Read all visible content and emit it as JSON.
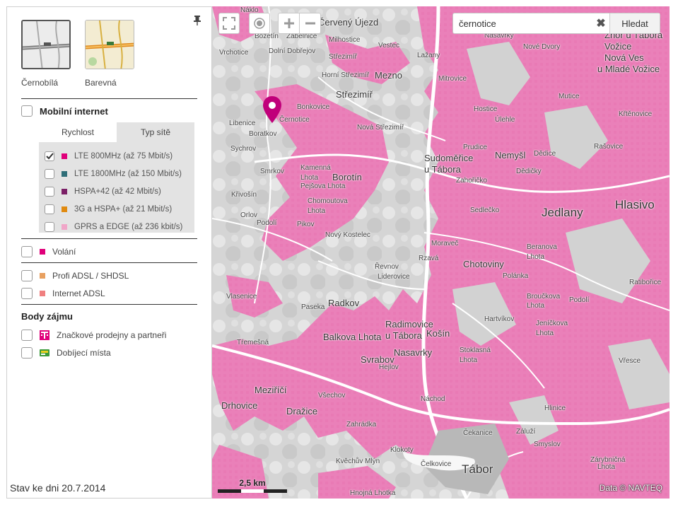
{
  "sidebar": {
    "map_styles": [
      {
        "label": "Černobílá",
        "selected": true
      },
      {
        "label": "Barevná",
        "selected": false
      }
    ],
    "mobile_internet": {
      "label": "Mobilní internet",
      "tabs": [
        "Rychlost",
        "Typ sítě"
      ],
      "options": [
        {
          "label": "LTE 800MHz (až 75 Mbit/s)",
          "color": "#e0007a",
          "checked": true
        },
        {
          "label": "LTE 1800MHz (až 150 Mbit/s)",
          "color": "#2f6e78",
          "checked": false
        },
        {
          "label": "HSPA+42 (až 42 Mbit/s)",
          "color": "#7b1f66",
          "checked": false
        },
        {
          "label": "3G a HSPA+ (až 21 Mbit/s)",
          "color": "#e08a10",
          "checked": false
        },
        {
          "label": "GPRS a EDGE (až 236 kbit/s)",
          "color": "#f0a6c8",
          "checked": false
        }
      ]
    },
    "calls": {
      "label": "Volání",
      "color": "#e0007a"
    },
    "fixed": [
      {
        "label": "Profi ADSL / SHDSL",
        "color": "#e8a060"
      },
      {
        "label": "Internet ADSL",
        "color": "#f08080"
      }
    ],
    "poi": {
      "title": "Body zájmu",
      "items": [
        {
          "label": "Značkové prodejny a partneři",
          "icon": "t-logo-icon",
          "color": "#e0007a"
        },
        {
          "label": "Dobíjecí místa",
          "icon": "card-icon",
          "color": "#3a9a3a"
        }
      ]
    },
    "status": "Stav ke dni 20.7.2014"
  },
  "map": {
    "search": {
      "value": "černotice",
      "button": "Hledat"
    },
    "scale": "2,5 km",
    "attribution": "Data © NAVTEQ",
    "coverage_color": "#ea80b9",
    "marker_color": "#c0007a",
    "places": [
      {
        "t": "Náklo"
      },
      {
        "t": "Červený Újezd"
      },
      {
        "t": "Božetín"
      },
      {
        "t": "Zábělnice"
      },
      {
        "t": "Milhostice"
      },
      {
        "t": "Vrchotice"
      },
      {
        "t": "Dolní Dobřejov"
      },
      {
        "t": "Střezimíř"
      },
      {
        "t": "Vestec"
      },
      {
        "t": "Lažany"
      },
      {
        "t": "Zhoř u Tábora"
      },
      {
        "t": "Vožice"
      },
      {
        "t": "Nová Ves"
      },
      {
        "t": "u Mladé Vožice"
      },
      {
        "t": "Nasavrky"
      },
      {
        "t": "Nové Dvory"
      },
      {
        "t": "Mezno"
      },
      {
        "t": "Střezimíř"
      },
      {
        "t": "Mitrovice"
      },
      {
        "t": "Horní Střezimíř"
      },
      {
        "t": "Mutice"
      },
      {
        "t": "Černotice"
      },
      {
        "t": "Bonkovice"
      },
      {
        "t": "Libenice"
      },
      {
        "t": "Boratkov"
      },
      {
        "t": "Nová Střezimíř"
      },
      {
        "t": "Hostice"
      },
      {
        "t": "Úlehle"
      },
      {
        "t": "Křtěnovice"
      },
      {
        "t": "Sychrov"
      },
      {
        "t": "Sudoměřice"
      },
      {
        "t": "u Tábora"
      },
      {
        "t": "Nemyšl"
      },
      {
        "t": "Prudice"
      },
      {
        "t": "Dědice"
      },
      {
        "t": "Rašovice"
      },
      {
        "t": "Kamenná"
      },
      {
        "t": "Lhota"
      },
      {
        "t": "Borotín"
      },
      {
        "t": "Smrkov"
      },
      {
        "t": "Dědičky"
      },
      {
        "t": "Zahořičko"
      },
      {
        "t": "Pejšova Lhota"
      },
      {
        "t": "Chomoutova"
      },
      {
        "t": "Lhota"
      },
      {
        "t": "Křivošín"
      },
      {
        "t": "Jedlany"
      },
      {
        "t": "Hlasivo"
      },
      {
        "t": "Sedlečko"
      },
      {
        "t": "Orlov"
      },
      {
        "t": "Podolí"
      },
      {
        "t": "Pikov"
      },
      {
        "t": "Nový Kostelec"
      },
      {
        "t": "Moraveč"
      },
      {
        "t": "Beranova"
      },
      {
        "t": "Lhota"
      },
      {
        "t": "Rzavá"
      },
      {
        "t": "Chotoviny"
      },
      {
        "t": "Řevnov"
      },
      {
        "t": "Liderovice"
      },
      {
        "t": "Polánka"
      },
      {
        "t": "Ratibořice"
      },
      {
        "t": "Vlasenice"
      },
      {
        "t": "Radkov"
      },
      {
        "t": "Broučkova"
      },
      {
        "t": "Lhota"
      },
      {
        "t": "Podolí"
      },
      {
        "t": "Paseka"
      },
      {
        "t": "Radimovice"
      },
      {
        "t": "u Tábora"
      },
      {
        "t": "Košín"
      },
      {
        "t": "Hartvíkov"
      },
      {
        "t": "Jeníčkova"
      },
      {
        "t": "Lhota"
      },
      {
        "t": "Balkova Lhota"
      },
      {
        "t": "Tŕemešná"
      },
      {
        "t": "Stoklasná"
      },
      {
        "t": "Lhota"
      },
      {
        "t": "Nasavrky"
      },
      {
        "t": "Svrabov"
      },
      {
        "t": "Hejlov"
      },
      {
        "t": "Vřesce"
      },
      {
        "t": "Meziříčí"
      },
      {
        "t": "Všechov"
      },
      {
        "t": "Drhovice"
      },
      {
        "t": "Dražice"
      },
      {
        "t": "Náchod"
      },
      {
        "t": "Hlinice"
      },
      {
        "t": "Zahrádka"
      },
      {
        "t": "Čekanice"
      },
      {
        "t": "Záluží"
      },
      {
        "t": "Smyslov"
      },
      {
        "t": "Klokoty"
      },
      {
        "t": "Čelkovice"
      },
      {
        "t": "Kvěchův Mlýn"
      },
      {
        "t": "Tábor"
      },
      {
        "t": "Zárybničná"
      },
      {
        "t": "Lhota"
      },
      {
        "t": "Hnojná Lhotka"
      }
    ]
  }
}
